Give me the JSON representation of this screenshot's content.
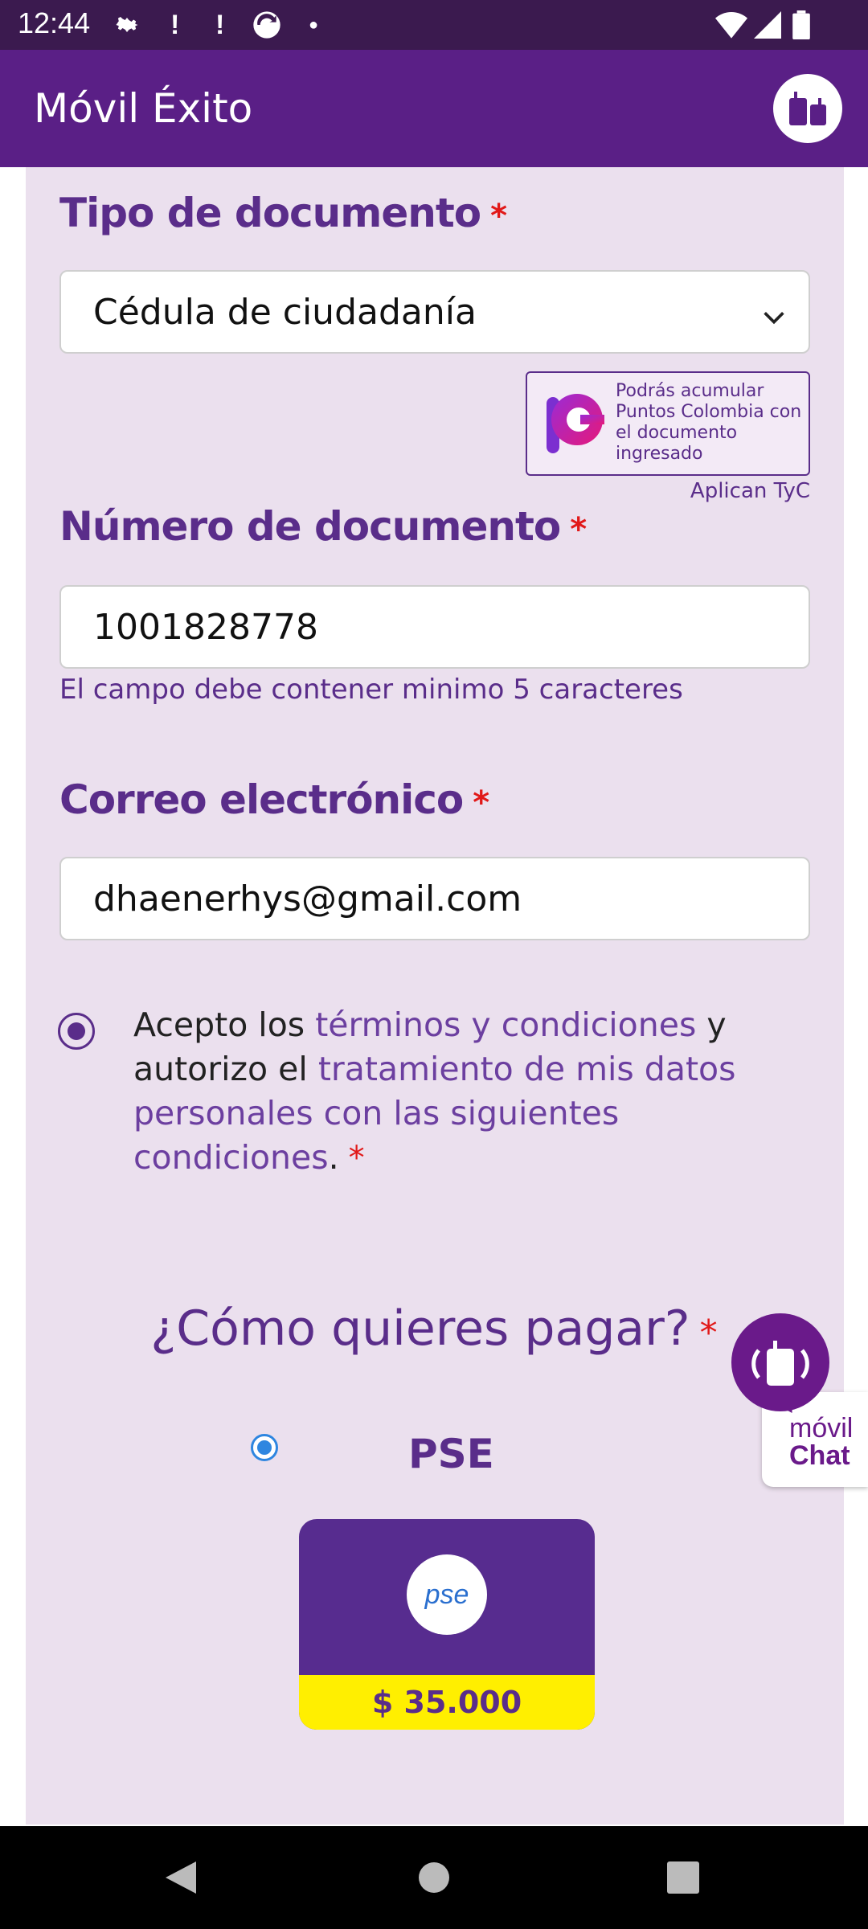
{
  "status_bar": {
    "time": "12:44",
    "icons": [
      "gear-icon",
      "alert-icon",
      "alert-icon",
      "sync-icon",
      "dot-icon",
      "wifi-icon",
      "signal-icon",
      "battery-icon"
    ]
  },
  "app_bar": {
    "title": "Móvil Éxito",
    "avatar_icon": "bag-icon"
  },
  "form": {
    "doc_type": {
      "label": "Tipo de documento",
      "required_mark": "*",
      "value": "Cédula de ciudadanía"
    },
    "badge": {
      "text": "Podrás acumular Puntos Colombia con el documento ingresado",
      "note": "Aplican TyC"
    },
    "doc_number": {
      "label": "Número de documento",
      "required_mark": "*",
      "value": "1001828778",
      "helper": "El campo debe contener minimo 5 caracteres"
    },
    "email": {
      "label": "Correo electrónico",
      "required_mark": "*",
      "value": "dhaenerhys@gmail.com"
    },
    "consent": {
      "prefix": "Acepto los ",
      "terms_link": "términos y condiciones",
      "middle": " y autorizo el ",
      "data_link": "tratamiento de mis datos personales con las siguientes condiciones",
      "suffix": ".",
      "required_mark": "*",
      "checked": true
    }
  },
  "payment": {
    "question": "¿Cómo quieres pagar?",
    "required_mark": "*",
    "option_label": "PSE",
    "selected": true,
    "logo_text": "pse",
    "price": "$ 35.000"
  },
  "chat": {
    "line1": "móvil",
    "line2": "Chat"
  },
  "colors": {
    "brand_purple": "#5a1f86",
    "accent_yellow": "#ffef00",
    "required_red": "#e11919"
  }
}
